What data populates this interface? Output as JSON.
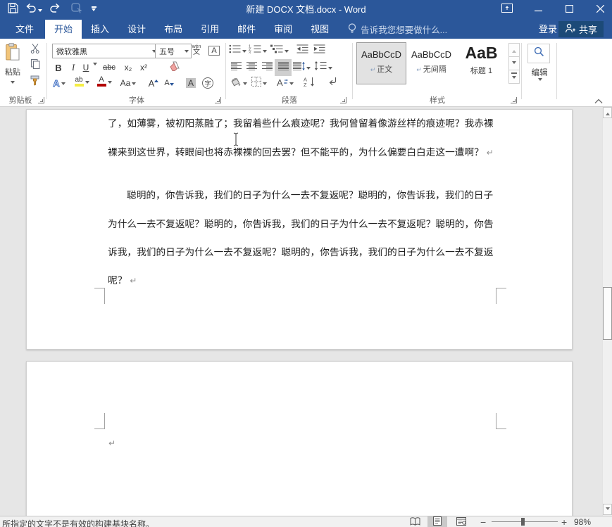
{
  "colors": {
    "accent_blue": "#2b579a",
    "share_button_bg": "#1c4a78",
    "highlight_yellow": "#f5ee44",
    "font_color_red": "#b30000"
  },
  "title_bar": {
    "title": "新建 DOCX 文档.docx - Word"
  },
  "tabs": {
    "file": "文件",
    "items": [
      "开始",
      "插入",
      "设计",
      "布局",
      "引用",
      "邮件",
      "审阅",
      "视图"
    ],
    "tell_me": "告诉我您想要做什么...",
    "sign_in": "登录",
    "share": "共享"
  },
  "ribbon": {
    "clipboard": {
      "paste": "粘贴",
      "group_label": "剪贴板"
    },
    "font": {
      "group_label": "字体",
      "name_value": "微软雅黑",
      "size_value": "五号",
      "bold": "B",
      "italic": "I",
      "underline": "U",
      "strikethrough": "abc",
      "subscript": "x₂",
      "superscript": "x²",
      "phonetic_top": "wén",
      "phonetic_bottom": "文",
      "char_border_a": "A",
      "text_effects_a": "A",
      "highlight_ab": "ab",
      "font_color_a": "A",
      "change_case": "Aa",
      "grow_a": "A",
      "shrink_a": "A",
      "char_shading_a": "A",
      "enclose_char": "字"
    },
    "paragraph": {
      "group_label": "段落"
    },
    "styles": {
      "group_label": "样式",
      "items": [
        {
          "sample": "AaBbCcD",
          "prefix": "↵",
          "label": "正文"
        },
        {
          "sample": "AaBbCcD",
          "prefix": "↵",
          "label": "无间隔"
        },
        {
          "sample": "AaB",
          "prefix": "",
          "label": "标题 1"
        }
      ]
    },
    "editing": {
      "group_label": "编辑"
    }
  },
  "document": {
    "pilcrow": "↵",
    "page1": {
      "lines": [
        "了，如薄雾，被初阳蒸融了；我留着些什么痕迹呢？我何曾留着像游丝样的痕迹呢？我赤裸",
        "裸来到这世界，转眼间也将赤裸裸的回去罢？但不能平的，为什么偏要白白走这一遭啊？",
        "聪明的，你告诉我，我们的日子为什么一去不复返呢？聪明的，你告诉我，我们的日子",
        "为什么一去不复返呢？聪明的，你告诉我，我们的日子为什么一去不复返呢？聪明的，你告",
        "诉我，我们的日子为什么一去不复返呢？聪明的，你告诉我，我们的日子为什么一去不复返",
        "呢？"
      ]
    }
  },
  "status_bar": {
    "message": "所指定的文字不是有效的构建基块名称。",
    "zoom_out": "−",
    "zoom_in": "+",
    "zoom_level": "98%"
  }
}
